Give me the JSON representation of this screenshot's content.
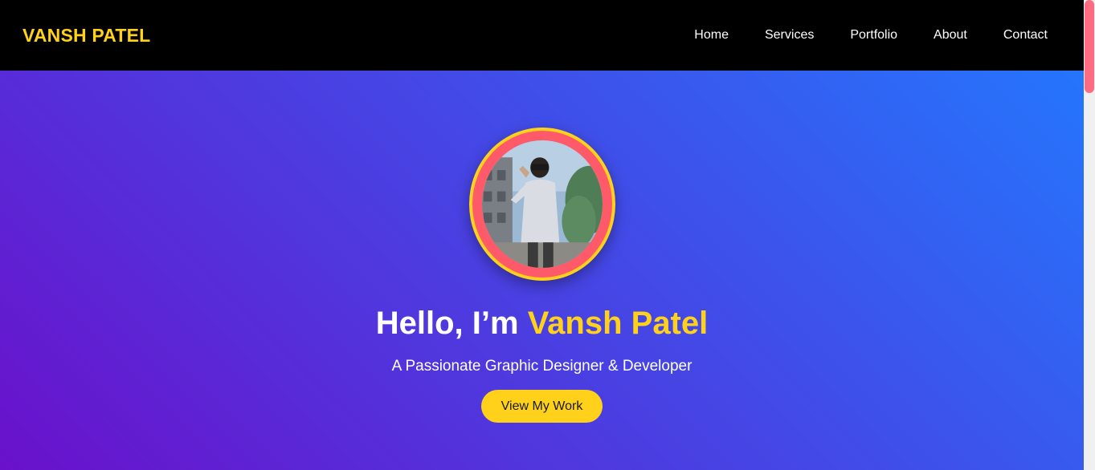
{
  "nav": {
    "brand": "VANSH PATEL",
    "links": [
      "Home",
      "Services",
      "Portfolio",
      "About",
      "Contact"
    ]
  },
  "hero": {
    "greeting": "Hello, I’m ",
    "name": "Vansh Patel",
    "subtitle": "A Passionate Graphic Designer & Developer",
    "cta_label": "View My Work",
    "photo_icon": "profile-photo"
  },
  "colors": {
    "accent": "#ffd11a",
    "ring": "#ff5a6a",
    "gradient_start": "#6a11cb",
    "gradient_end": "#2575fc",
    "scroll_thumb": "#ff6b81"
  }
}
